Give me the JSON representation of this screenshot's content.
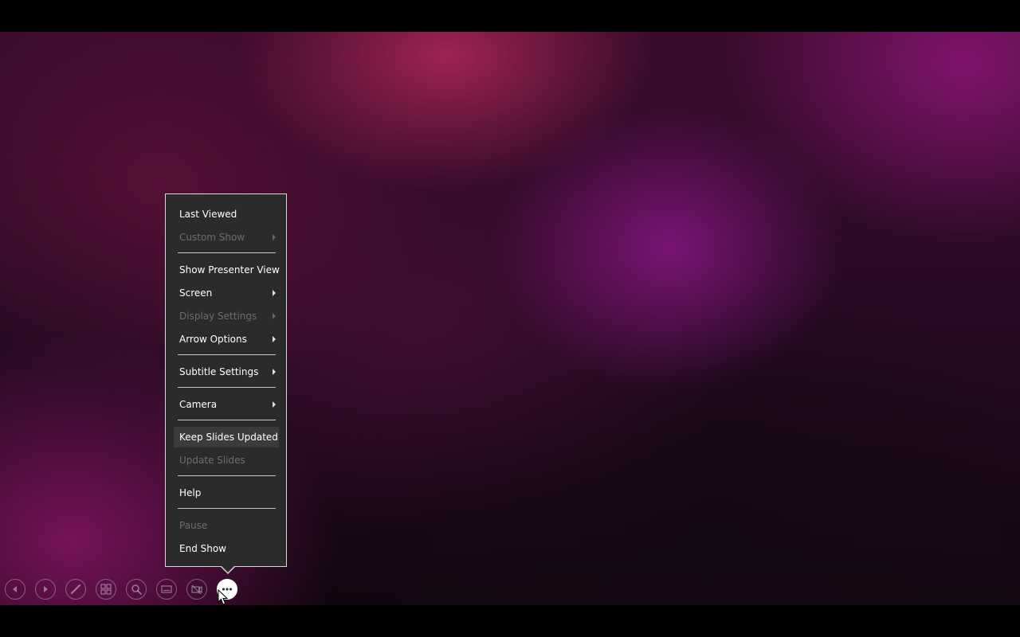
{
  "menu": {
    "items": [
      {
        "label": "Last Viewed",
        "enabled": true,
        "submenu": false
      },
      {
        "label": "Custom Show",
        "enabled": false,
        "submenu": true
      },
      {
        "label": "Show Presenter View",
        "enabled": true,
        "submenu": false
      },
      {
        "label": "Screen",
        "enabled": true,
        "submenu": true
      },
      {
        "label": "Display Settings",
        "enabled": false,
        "submenu": true
      },
      {
        "label": "Arrow Options",
        "enabled": true,
        "submenu": true
      },
      {
        "label": "Subtitle Settings",
        "enabled": true,
        "submenu": true
      },
      {
        "label": "Camera",
        "enabled": true,
        "submenu": true
      },
      {
        "label": "Keep Slides Updated",
        "enabled": true,
        "submenu": false,
        "highlighted": true
      },
      {
        "label": "Update Slides",
        "enabled": false,
        "submenu": false
      },
      {
        "label": "Help",
        "enabled": true,
        "submenu": false
      },
      {
        "label": "Pause",
        "enabled": false,
        "submenu": false
      },
      {
        "label": "End Show",
        "enabled": true,
        "submenu": false
      }
    ]
  },
  "toolbar": {
    "buttons": [
      {
        "icon": "previous-icon"
      },
      {
        "icon": "next-icon"
      },
      {
        "icon": "pen-icon"
      },
      {
        "icon": "see-all-slides-icon"
      },
      {
        "icon": "zoom-icon"
      },
      {
        "icon": "subtitles-icon"
      },
      {
        "icon": "camera-off-icon"
      },
      {
        "icon": "more-options-icon",
        "active": true
      }
    ]
  },
  "colors": {
    "menu_background": "#2b2b2b",
    "menu_border": "#d8d8d8",
    "menu_text": "#ffffff",
    "menu_text_disabled": "#6e6e6e"
  }
}
